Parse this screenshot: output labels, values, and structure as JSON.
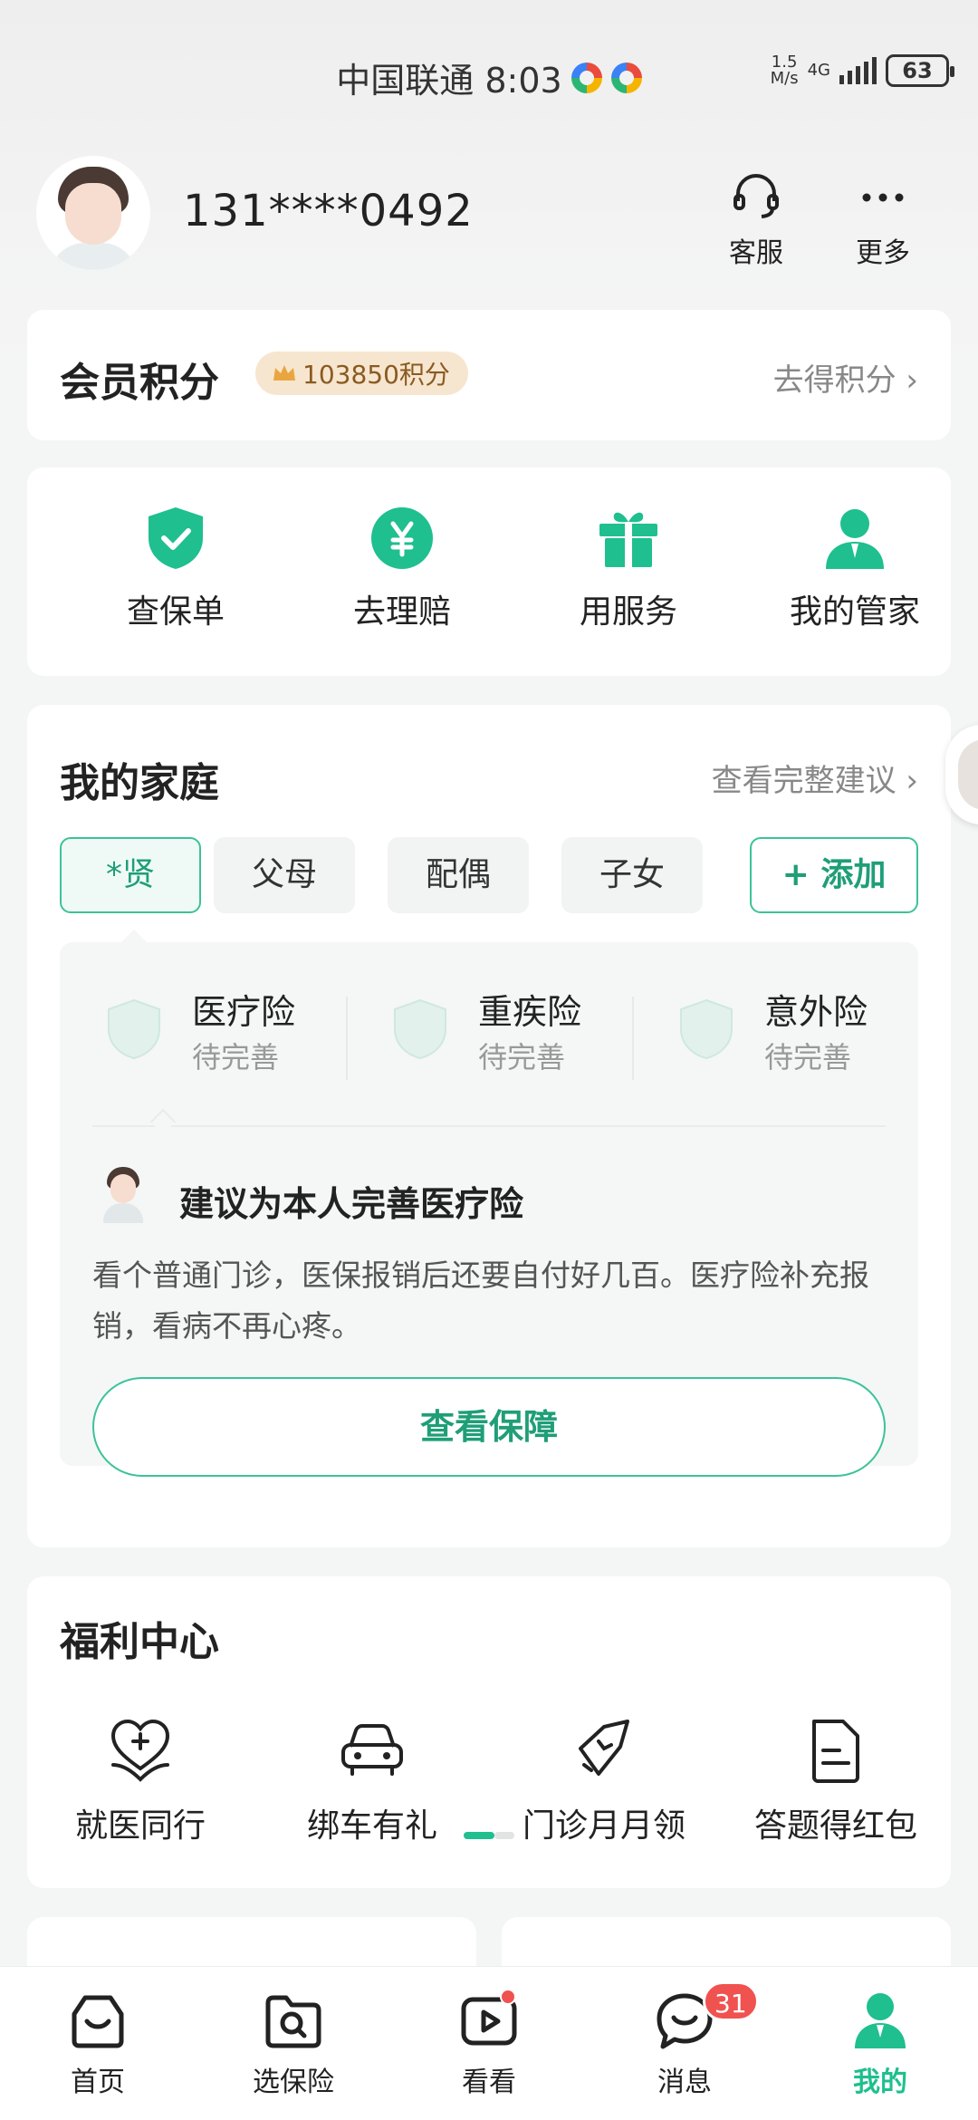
{
  "status_bar": {
    "carrier_time": "中国联通 8:03",
    "net_speed_value": "1.5",
    "net_speed_unit": "M/s",
    "net_type": "4G",
    "battery": "63"
  },
  "header": {
    "phone": "131****0492",
    "service_label": "客服",
    "more_label": "更多"
  },
  "points": {
    "title": "会员积分",
    "badge": "103850积分",
    "link": "去得积分 ›"
  },
  "quick_actions": [
    {
      "label": "查保单",
      "icon": "shield-check-icon"
    },
    {
      "label": "去理赔",
      "icon": "yen-circle-icon"
    },
    {
      "label": "用服务",
      "icon": "gift-icon"
    },
    {
      "label": "我的管家",
      "icon": "butler-icon"
    }
  ],
  "family": {
    "title": "我的家庭",
    "link": "查看完整建议 ›",
    "chips": [
      "*贤",
      "父母",
      "配偶",
      "子女"
    ],
    "add_label": "+ 添加",
    "insurances": [
      {
        "name": "医疗险",
        "state": "待完善"
      },
      {
        "name": "重疾险",
        "state": "待完善"
      },
      {
        "name": "意外险",
        "state": "待完善"
      }
    ],
    "advice_title": "建议为本人完善医疗险",
    "advice_text": "看个普通门诊，医保报销后还要自付好几百。医疗险补充报销，看病不再心疼。",
    "view_button": "查看保障"
  },
  "welfare": {
    "title": "福利中心",
    "items": [
      {
        "label": "就医同行",
        "icon": "heart-care-icon"
      },
      {
        "label": "绑车有礼",
        "icon": "car-icon"
      },
      {
        "label": "门诊月月领",
        "icon": "star-ticket-icon"
      },
      {
        "label": "答题得红包",
        "icon": "document-icon"
      }
    ]
  },
  "bottom_nav": [
    {
      "label": "首页",
      "icon": "home-icon"
    },
    {
      "label": "选保险",
      "icon": "search-folder-icon"
    },
    {
      "label": "看看",
      "icon": "video-icon"
    },
    {
      "label": "消息",
      "icon": "chat-icon",
      "badge": "31"
    },
    {
      "label": "我的",
      "icon": "profile-icon",
      "active": true
    }
  ],
  "colors": {
    "accent": "#1fbf8f",
    "badge_red": "#f0524f",
    "points_badge_bg": "#f7e6cf"
  }
}
